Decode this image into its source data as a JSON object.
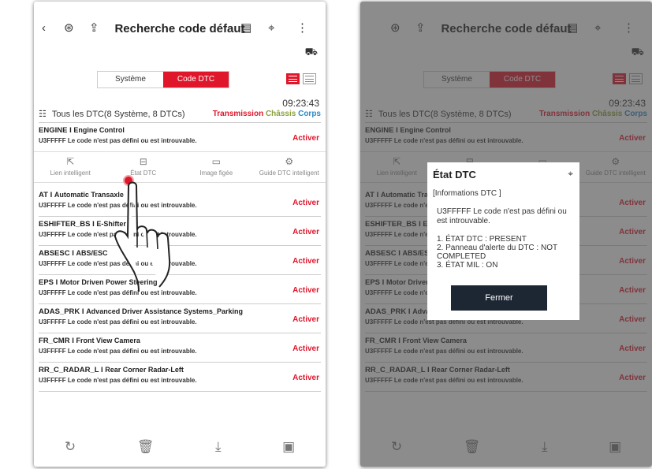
{
  "header": {
    "title": "Recherche code défaut",
    "back": "‹",
    "more": "⋮"
  },
  "tabs": [
    {
      "label": "Système",
      "active": false
    },
    {
      "label": "Code DTC",
      "active": true
    }
  ],
  "time": "09:23:43",
  "filter": {
    "label": "Tous les DTC(8 Système, 8 DTCs)",
    "transmission": "Transmission",
    "chassis": "Châssis",
    "corps": "Corps"
  },
  "activate_label": "Activer",
  "dtcs": [
    {
      "name": "ENGINE",
      "sys": "Engine Control",
      "desc": "U3FFFFF Le code n'est pas défini ou est introuvable."
    },
    {
      "name": "AT",
      "sys": "Automatic Transaxle",
      "desc": "U3FFFFF Le code n'est pas défini ou est introuvable."
    },
    {
      "name": "ESHIFTER_BS",
      "sys": "E-Shifter",
      "desc": "U3FFFFF Le code n'est pas défini ou est introuvable."
    },
    {
      "name": "ABSESC",
      "sys": "ABS/ESC",
      "desc": "U3FFFFF Le code n'est pas défini ou est introuvable."
    },
    {
      "name": "EPS",
      "sys": "Motor Driven Power Steering",
      "desc": "U3FFFFF Le code n'est pas défini ou est introuvable."
    },
    {
      "name": "ADAS_PRK",
      "sys": "Advanced Driver Assistance Systems_Parking",
      "desc": "U3FFFFF Le code n'est pas défini ou est introuvable."
    },
    {
      "name": "FR_CMR",
      "sys": "Front View Camera",
      "desc": "U3FFFFF Le code n'est pas défini ou est introuvable."
    },
    {
      "name": "RR_C_RADAR_L",
      "sys": "Rear Corner Radar-Left",
      "desc": "U3FFFFF Le code n'est pas défini ou est introuvable."
    }
  ],
  "sub_menu": [
    {
      "label": "Lien intelligent",
      "icon": "share-icon"
    },
    {
      "label": "État DTC",
      "icon": "status-icon"
    },
    {
      "label": "Image figée",
      "icon": "freeze-frame-icon"
    },
    {
      "label": "Guide DTC intelligent",
      "icon": "gear-icon"
    }
  ],
  "modal": {
    "title": "État DTC",
    "header": "[Informations DTC ]",
    "code_line": "U3FFFFF  Le code n'est pas défini ou est introuvable.",
    "status1": "1. ÉTAT DTC : PRESENT",
    "status2": "2. Panneau d'alerte du DTC : NOT COMPLETED",
    "status3": "3. ÉTAT MIL : ON",
    "button": "Fermer"
  },
  "colors": {
    "accent": "#e0162b",
    "transmission": "#e0162b",
    "chassis": "#8aa03c",
    "corps": "#2a8ac9",
    "modal_button": "#1c2733"
  }
}
